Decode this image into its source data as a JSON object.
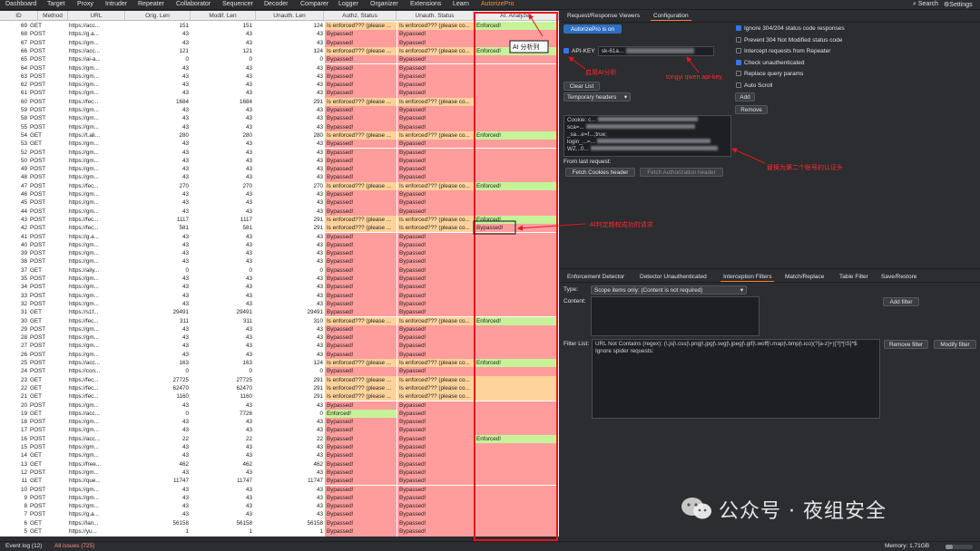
{
  "menu": {
    "items": [
      "Dashboard",
      "Target",
      "Proxy",
      "Intruder",
      "Repeater",
      "Collaborator",
      "Sequencer",
      "Decoder",
      "Comparer",
      "Logger",
      "Organizer",
      "Extensions",
      "Learn",
      "AutorizePro"
    ],
    "search": "Search",
    "settings": "Settings"
  },
  "columns": [
    "ID",
    "Method",
    "URL",
    "Orig. Len",
    "Modif. Len",
    "Unauth. Len",
    "Authz. Status",
    "Unauth. Status",
    "AI. Analyzer"
  ],
  "rows": [
    [
      "69",
      "GET",
      "https://acc...",
      "151",
      "151",
      "124",
      "Is enforced??? (please ...",
      "Is enforced??? (please co...",
      "Enforced!"
    ],
    [
      "68",
      "POST",
      "https://g.a...",
      "43",
      "43",
      "43",
      "Bypassed!",
      "Bypassed!",
      ""
    ],
    [
      "67",
      "POST",
      "https://gm...",
      "43",
      "43",
      "43",
      "Bypassed!",
      "Bypassed!",
      ""
    ],
    [
      "66",
      "POST",
      "https://acc...",
      "121",
      "121",
      "124",
      "Is enforced??? (please ...",
      "Is enforced??? (please co...",
      "Enforced!"
    ],
    [
      "65",
      "POST",
      "https://ai-a...",
      "0",
      "0",
      "0",
      "Bypassed!",
      "Bypassed!",
      ""
    ],
    [
      "64",
      "POST",
      "https://gm...",
      "43",
      "43",
      "43",
      "Bypassed!",
      "Bypassed!",
      ""
    ],
    [
      "63",
      "POST",
      "https://gm...",
      "43",
      "43",
      "43",
      "Bypassed!",
      "Bypassed!",
      ""
    ],
    [
      "62",
      "POST",
      "https://gm...",
      "43",
      "43",
      "43",
      "Bypassed!",
      "Bypassed!",
      ""
    ],
    [
      "61",
      "POST",
      "https://gm...",
      "43",
      "43",
      "43",
      "Bypassed!",
      "Bypassed!",
      ""
    ],
    [
      "60",
      "POST",
      "https://fec...",
      "1684",
      "1684",
      "291",
      "Is enforced??? (please ...",
      "Is enforced??? (please co...",
      ""
    ],
    [
      "59",
      "POST",
      "https://gm...",
      "43",
      "43",
      "43",
      "Bypassed!",
      "Bypassed!",
      ""
    ],
    [
      "58",
      "POST",
      "https://gm...",
      "43",
      "43",
      "43",
      "Bypassed!",
      "Bypassed!",
      ""
    ],
    [
      "55",
      "POST",
      "https://gm...",
      "43",
      "43",
      "43",
      "Bypassed!",
      "Bypassed!",
      ""
    ],
    [
      "54",
      "GET",
      "https://t.ali...",
      "280",
      "280",
      "280",
      "Is enforced??? (please ...",
      "Is enforced??? (please co...",
      "Enforced!"
    ],
    [
      "53",
      "GET",
      "https://gm...",
      "43",
      "43",
      "43",
      "Bypassed!",
      "Bypassed!",
      ""
    ],
    [
      "52",
      "POST",
      "https://gm...",
      "43",
      "43",
      "43",
      "Bypassed!",
      "Bypassed!",
      ""
    ],
    [
      "50",
      "POST",
      "https://gm...",
      "43",
      "43",
      "43",
      "Bypassed!",
      "Bypassed!",
      ""
    ],
    [
      "49",
      "POST",
      "https://gm...",
      "43",
      "43",
      "43",
      "Bypassed!",
      "Bypassed!",
      ""
    ],
    [
      "48",
      "POST",
      "https://gm...",
      "43",
      "43",
      "43",
      "Bypassed!",
      "Bypassed!",
      ""
    ],
    [
      "47",
      "POST",
      "https://fec...",
      "270",
      "270",
      "270",
      "Is enforced??? (please ...",
      "Is enforced??? (please co...",
      "Enforced!"
    ],
    [
      "46",
      "POST",
      "https://gm...",
      "43",
      "43",
      "43",
      "Bypassed!",
      "Bypassed!",
      ""
    ],
    [
      "45",
      "POST",
      "https://gm...",
      "43",
      "43",
      "43",
      "Bypassed!",
      "Bypassed!",
      ""
    ],
    [
      "44",
      "POST",
      "https://gm...",
      "43",
      "43",
      "43",
      "Bypassed!",
      "Bypassed!",
      ""
    ],
    [
      "43",
      "POST",
      "https://fec...",
      "1117",
      "1117",
      "291",
      "Is enforced??? (please ...",
      "Is enforced??? (please co...",
      "Enforced!"
    ],
    [
      "42",
      "POST",
      "https://fec...",
      "581",
      "581",
      "291",
      "Is enforced??? (please ...",
      "Is enforced??? (please co...",
      "Bypassed!"
    ],
    [
      "41",
      "POST",
      "https://g.a...",
      "43",
      "43",
      "43",
      "Bypassed!",
      "Bypassed!",
      ""
    ],
    [
      "40",
      "POST",
      "https://gm...",
      "43",
      "43",
      "43",
      "Bypassed!",
      "Bypassed!",
      ""
    ],
    [
      "39",
      "POST",
      "https://gm...",
      "43",
      "43",
      "43",
      "Bypassed!",
      "Bypassed!",
      ""
    ],
    [
      "38",
      "POST",
      "https://gm...",
      "43",
      "43",
      "43",
      "Bypassed!",
      "Bypassed!",
      ""
    ],
    [
      "37",
      "GET",
      "https://aliy...",
      "0",
      "0",
      "0",
      "Bypassed!",
      "Bypassed!",
      ""
    ],
    [
      "35",
      "POST",
      "https://gm...",
      "43",
      "43",
      "43",
      "Bypassed!",
      "Bypassed!",
      ""
    ],
    [
      "34",
      "POST",
      "https://gm...",
      "43",
      "43",
      "43",
      "Bypassed!",
      "Bypassed!",
      ""
    ],
    [
      "33",
      "POST",
      "https://gm...",
      "43",
      "43",
      "43",
      "Bypassed!",
      "Bypassed!",
      ""
    ],
    [
      "32",
      "POST",
      "https://gm...",
      "43",
      "43",
      "43",
      "Bypassed!",
      "Bypassed!",
      ""
    ],
    [
      "31",
      "GET",
      "https://s1f...",
      "29491",
      "29491",
      "29491",
      "Bypassed!",
      "Bypassed!",
      ""
    ],
    [
      "30",
      "GET",
      "https://fec...",
      "311",
      "311",
      "310",
      "Is enforced??? (please ...",
      "Is enforced??? (please co...",
      "Enforced!"
    ],
    [
      "29",
      "POST",
      "https://gm...",
      "43",
      "43",
      "43",
      "Bypassed!",
      "Bypassed!",
      ""
    ],
    [
      "28",
      "POST",
      "https://gm...",
      "43",
      "43",
      "43",
      "Bypassed!",
      "Bypassed!",
      ""
    ],
    [
      "27",
      "POST",
      "https://gm...",
      "43",
      "43",
      "43",
      "Bypassed!",
      "Bypassed!",
      ""
    ],
    [
      "26",
      "POST",
      "https://gm...",
      "43",
      "43",
      "43",
      "Bypassed!",
      "Bypassed!",
      ""
    ],
    [
      "25",
      "POST",
      "https://acc...",
      "163",
      "163",
      "124",
      "Is enforced??? (please ...",
      "Is enforced??? (please co...",
      "Enforced!"
    ],
    [
      "24",
      "POST",
      "https://con...",
      "0",
      "0",
      "0",
      "Bypassed!",
      "Bypassed!",
      ""
    ],
    [
      "23",
      "GET",
      "https://fec...",
      "27725",
      "27725",
      "291",
      "Is enforced??? (please ...",
      "Is enforced??? (please co...",
      ""
    ],
    [
      "22",
      "GET",
      "https://fec...",
      "62470",
      "62470",
      "291",
      "Is enforced??? (please ...",
      "Is enforced??? (please co...",
      ""
    ],
    [
      "21",
      "GET",
      "https://fec...",
      "1160",
      "1160",
      "291",
      "Is enforced??? (please ...",
      "Is enforced??? (please co...",
      ""
    ],
    [
      "20",
      "POST",
      "https://gm...",
      "43",
      "43",
      "43",
      "Bypassed!",
      "Bypassed!",
      ""
    ],
    [
      "19",
      "GET",
      "https://acc...",
      "0",
      "7726",
      "0",
      "Enforced!",
      "Bypassed!",
      ""
    ],
    [
      "18",
      "POST",
      "https://gm...",
      "43",
      "43",
      "43",
      "Bypassed!",
      "Bypassed!",
      ""
    ],
    [
      "17",
      "POST",
      "https://gm...",
      "43",
      "43",
      "43",
      "Bypassed!",
      "Bypassed!",
      ""
    ],
    [
      "16",
      "POST",
      "https://acc...",
      "22",
      "22",
      "22",
      "Bypassed!",
      "Bypassed!",
      "Enforced!"
    ],
    [
      "15",
      "POST",
      "https://gm...",
      "43",
      "43",
      "43",
      "Bypassed!",
      "Bypassed!",
      ""
    ],
    [
      "14",
      "GET",
      "https://gm...",
      "43",
      "43",
      "43",
      "Bypassed!",
      "Bypassed!",
      ""
    ],
    [
      "13",
      "GET",
      "https://free...",
      "462",
      "462",
      "462",
      "Bypassed!",
      "Bypassed!",
      ""
    ],
    [
      "12",
      "POST",
      "https://gm...",
      "43",
      "43",
      "43",
      "Bypassed!",
      "Bypassed!",
      ""
    ],
    [
      "11",
      "GET",
      "https://que...",
      "11747",
      "11747",
      "11747",
      "Bypassed!",
      "Bypassed!",
      ""
    ],
    [
      "10",
      "POST",
      "https://gm...",
      "43",
      "43",
      "43",
      "Bypassed!",
      "Bypassed!",
      ""
    ],
    [
      "9",
      "POST",
      "https://gm...",
      "43",
      "43",
      "43",
      "Bypassed!",
      "Bypassed!",
      ""
    ],
    [
      "8",
      "POST",
      "https://gm...",
      "43",
      "43",
      "43",
      "Bypassed!",
      "Bypassed!",
      ""
    ],
    [
      "7",
      "POST",
      "https://g.a...",
      "43",
      "43",
      "43",
      "Bypassed!",
      "Bypassed!",
      ""
    ],
    [
      "6",
      "GET",
      "https://lan...",
      "56158",
      "56158",
      "56158",
      "Bypassed!",
      "Bypassed!",
      ""
    ],
    [
      "5",
      "GET",
      "https://yu...",
      "1",
      "1",
      "1",
      "Bypassed!",
      "Bypassed!",
      ""
    ],
    [
      "4",
      "POST",
      "https://g.a...",
      "43",
      "43",
      "43",
      "Bypassed!",
      "Bypassed!",
      ""
    ]
  ],
  "rowColors": {
    "authz": [
      "o",
      "r",
      "r",
      "o",
      "r",
      "r",
      "r",
      "r",
      "r",
      "o",
      "r",
      "r",
      "r",
      "o",
      "r",
      "r",
      "r",
      "r",
      "r",
      "o",
      "r",
      "r",
      "r",
      "o",
      "o",
      "r",
      "r",
      "r",
      "r",
      "r",
      "r",
      "r",
      "r",
      "r",
      "r",
      "o",
      "r",
      "r",
      "r",
      "r",
      "o",
      "r",
      "o",
      "o",
      "o",
      "r",
      "g",
      "r",
      "r",
      "r",
      "r",
      "r",
      "r",
      "r",
      "r",
      "r",
      "r",
      "r",
      "r",
      "r",
      "r",
      "r"
    ],
    "unauth": [
      "o",
      "r",
      "r",
      "o",
      "r",
      "r",
      "r",
      "r",
      "r",
      "o",
      "r",
      "r",
      "r",
      "o",
      "r",
      "r",
      "r",
      "r",
      "r",
      "o",
      "r",
      "r",
      "r",
      "o",
      "o",
      "r",
      "r",
      "r",
      "r",
      "r",
      "r",
      "r",
      "r",
      "r",
      "r",
      "o",
      "r",
      "r",
      "r",
      "r",
      "o",
      "r",
      "o",
      "o",
      "o",
      "r",
      "r",
      "r",
      "r",
      "r",
      "r",
      "r",
      "r",
      "r",
      "r",
      "r",
      "r",
      "r",
      "r",
      "r",
      "r",
      "r"
    ],
    "ai": [
      "g",
      "r",
      "r",
      "g",
      "r",
      "r",
      "r",
      "r",
      "r",
      "r",
      "r",
      "r",
      "r",
      "g",
      "r",
      "r",
      "r",
      "r",
      "r",
      "g",
      "r",
      "r",
      "r",
      "g",
      "r",
      "r",
      "r",
      "r",
      "r",
      "r",
      "r",
      "r",
      "r",
      "r",
      "r",
      "g",
      "r",
      "r",
      "r",
      "r",
      "g",
      "r",
      "o",
      "o",
      "o",
      "r",
      "r",
      "r",
      "r",
      "g",
      "r",
      "r",
      "r",
      "r",
      "r",
      "r",
      "r",
      "r",
      "r",
      "r",
      "r",
      "r"
    ]
  },
  "colors": {
    "r": "#ff9d9d",
    "g": "#c6f29a",
    "o": "#ffd39b",
    "annotation": "#e8151b"
  },
  "right": {
    "tabs": [
      "Request/Response Viewers",
      "Configuration"
    ],
    "autorize_button": "AutorizePro is on",
    "apikey_label": "API-KEY",
    "apikey_value": "sk-61a...",
    "clear_list": "Clear List",
    "headers_select": "Temporary headers",
    "add": "Add",
    "remove": "Remove",
    "headers_text": [
      "Cookie: c...",
      "sca=...",
      "_sa...e=f...;true;",
      "login_...=...",
      "WZ...0..."
    ],
    "from_last": "From last request:",
    "fetch_cookies": "Fetch Cookies header",
    "fetch_auth": "Fetch Authorization header",
    "checks": [
      {
        "label": "Ignore 304/204 status code responses",
        "on": true
      },
      {
        "label": "Prevent 304 Not Modified status code",
        "on": false
      },
      {
        "label": "Intercept requests from Repeater",
        "on": false
      },
      {
        "label": "Check unauthenticated",
        "on": true
      },
      {
        "label": "Replace query params",
        "on": false
      },
      {
        "label": "Auto Scroll",
        "on": false
      }
    ],
    "bottom_tabs": [
      "Enforcement Detector",
      "Detector Unauthenticated",
      "Interception Filters",
      "Match/Replace",
      "Table Filter",
      "Save/Restore"
    ],
    "type_label": "Type:",
    "type_value": "Scope items only: (Content is not required)",
    "content_label": "Content:",
    "add_filter": "Add filter",
    "filter_list_label": "Filter List:",
    "filter_line1": "URL Not Contains (regex): (\\.js|\\.css|\\.png|\\.jpg|\\.svg|\\.jpeg|\\.gif|\\.woff|\\.map|\\.bmp|\\.ico)(?[a-z]+)[?]*[\\S]*$",
    "filter_line2": "Ignore spider requests:",
    "remove_filter": "Remove filter",
    "modify_filter": "Modify filter"
  },
  "annotations": {
    "ai_column": "AI 分析列",
    "enable_ai": "启用AI分析",
    "api_key": "tongyi qwen api-key",
    "replace_header": "替换为第二个账号的认证头",
    "ai_bypass": "AI判定越权成功的请求"
  },
  "status": {
    "event_log": "Event log (12)",
    "all_issues": "All issues (725)",
    "memory": "Memory: 1.71GB"
  },
  "watermark": "公众号 · 夜组安全"
}
